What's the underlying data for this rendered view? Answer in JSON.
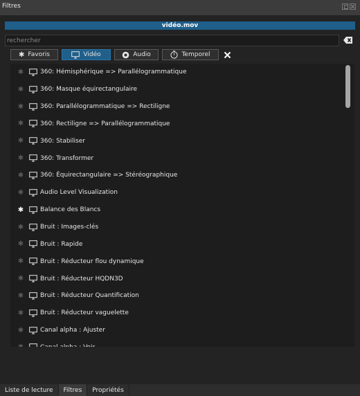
{
  "window": {
    "title": "Filtres"
  },
  "clip": {
    "name": "vidéo.mov"
  },
  "search": {
    "value": "",
    "placeholder": "rechercher"
  },
  "tabs": [
    {
      "label": "Favoris",
      "icon": "star-icon",
      "active": false
    },
    {
      "label": "Vidéo",
      "icon": "monitor-icon",
      "active": true
    },
    {
      "label": "Audio",
      "icon": "speaker-icon",
      "active": false
    },
    {
      "label": "Temporel",
      "icon": "timer-icon",
      "active": false
    }
  ],
  "filters": [
    {
      "label": "360: Hémisphérique => Parallélogrammatique",
      "favorite": false
    },
    {
      "label": "360: Masque équirectangulaire",
      "favorite": false
    },
    {
      "label": "360: Parallélogrammatique => Rectiligne",
      "favorite": false
    },
    {
      "label": "360: Rectiligne => Parallélogrammatique",
      "favorite": false
    },
    {
      "label": "360: Stabiliser",
      "favorite": false
    },
    {
      "label": "360: Transformer",
      "favorite": false
    },
    {
      "label": "360: Équirectangulaire => Stéréographique",
      "favorite": false
    },
    {
      "label": "Audio Level Visualization",
      "favorite": false
    },
    {
      "label": "Balance des Blancs",
      "favorite": true
    },
    {
      "label": "Bruit : Images-clés",
      "favorite": false
    },
    {
      "label": "Bruit : Rapide",
      "favorite": false
    },
    {
      "label": "Bruit : Réducteur flou dynamique",
      "favorite": false
    },
    {
      "label": "Bruit : Réducteur HQDN3D",
      "favorite": false
    },
    {
      "label": "Bruit : Réducteur Quantification",
      "favorite": false
    },
    {
      "label": "Bruit : Réducteur vaguelette",
      "favorite": false
    },
    {
      "label": "Canal alpha : Ajuster",
      "favorite": false
    },
    {
      "label": "Canal alpha : Voir",
      "favorite": false
    }
  ],
  "bottom_tabs": [
    {
      "label": "Liste de lecture",
      "active": false
    },
    {
      "label": "Filtres",
      "active": true
    },
    {
      "label": "Propriétés",
      "active": false
    }
  ],
  "colors": {
    "accent": "#1f5f8a",
    "background": "#232323",
    "list_background": "#1d1d1d"
  }
}
